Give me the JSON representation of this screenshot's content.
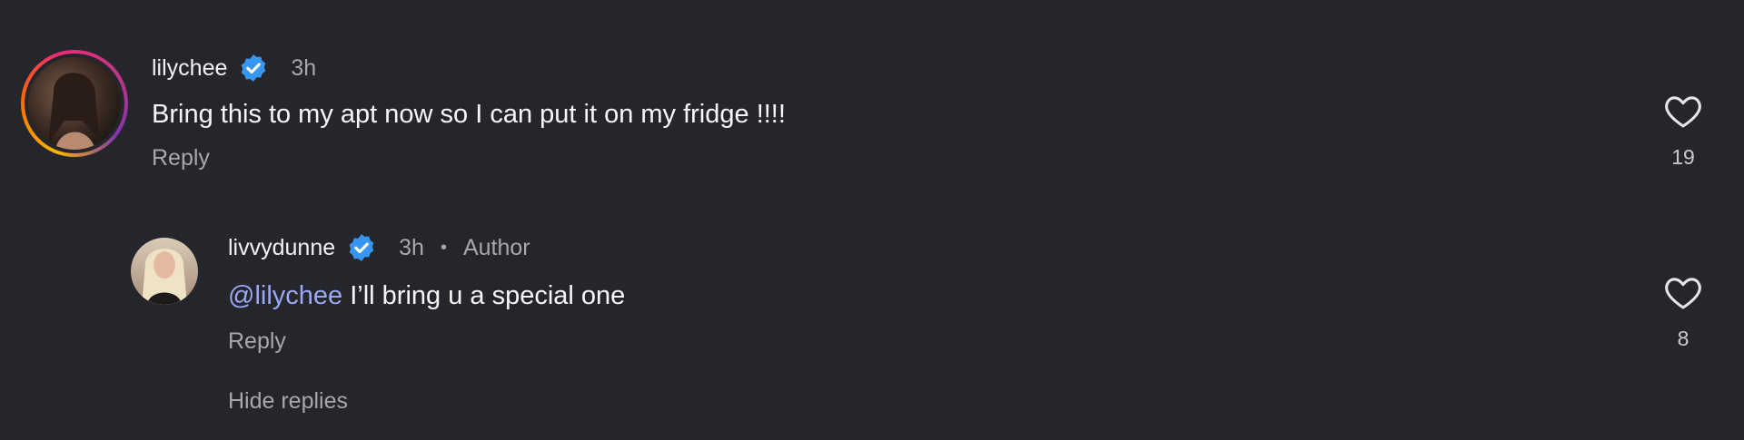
{
  "comments": [
    {
      "username": "lilychee",
      "time": "3h",
      "text": "Bring this to my apt now so I can put it on my fridge !!!!",
      "reply_label": "Reply",
      "likes": "19",
      "verified": true
    }
  ],
  "replies": [
    {
      "username": "livvydunne",
      "time": "3h",
      "dot": "•",
      "badge": "Author",
      "mention": "@lilychee",
      "text": " I’ll bring u a special one",
      "reply_label": "Reply",
      "likes": "8",
      "verified": true
    }
  ],
  "thread": {
    "hide_replies_label": "Hide replies"
  },
  "colors": {
    "background": "#25262b",
    "verified_blue": "#3797f0",
    "mention": "#9aa8f5",
    "secondary_text": "#a7a8ad"
  },
  "icons": [
    "verified-badge-icon",
    "heart-outline-icon"
  ]
}
